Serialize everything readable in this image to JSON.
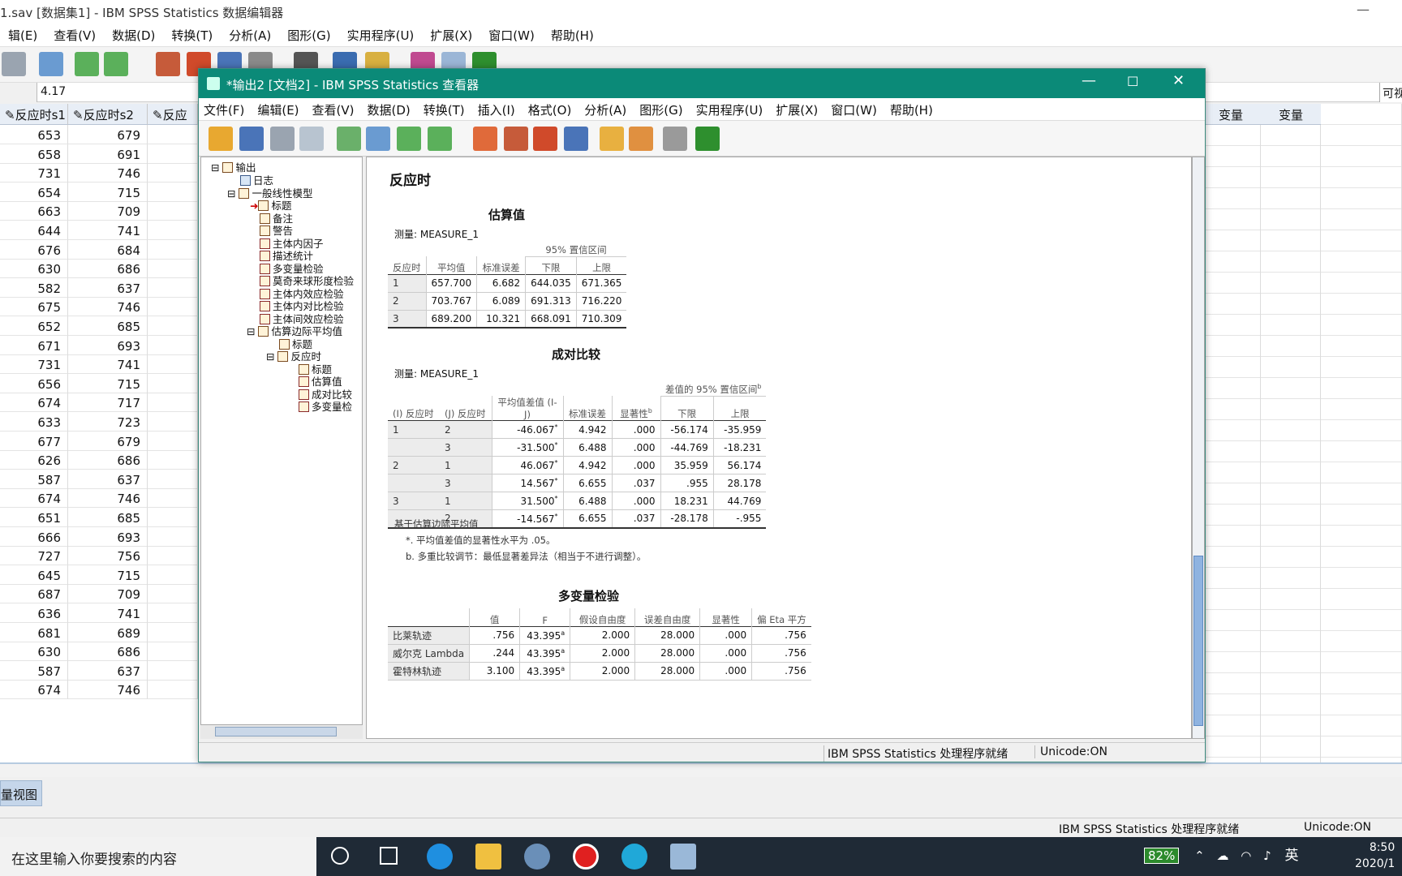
{
  "data_editor": {
    "title": "1.sav [数据集1] - IBM SPSS Statistics 数据编辑器",
    "menu": [
      "辑(E)",
      "查看(V)",
      "数据(D)",
      "转换(T)",
      "分析(A)",
      "图形(G)",
      "实用程序(U)",
      "扩展(X)",
      "窗口(W)",
      "帮助(H)"
    ],
    "cell_value": "4.17",
    "visible_label": "可视",
    "columns": [
      "反应时s1",
      "反应时s2",
      "反应"
    ],
    "rows": [
      [
        "653",
        "679"
      ],
      [
        "658",
        "691"
      ],
      [
        "731",
        "746"
      ],
      [
        "654",
        "715"
      ],
      [
        "663",
        "709"
      ],
      [
        "644",
        "741"
      ],
      [
        "676",
        "684"
      ],
      [
        "630",
        "686"
      ],
      [
        "582",
        "637"
      ],
      [
        "675",
        "746"
      ],
      [
        "652",
        "685"
      ],
      [
        "671",
        "693"
      ],
      [
        "731",
        "741"
      ],
      [
        "656",
        "715"
      ],
      [
        "674",
        "717"
      ],
      [
        "633",
        "723"
      ],
      [
        "677",
        "679"
      ],
      [
        "626",
        "686"
      ],
      [
        "587",
        "637"
      ],
      [
        "674",
        "746"
      ],
      [
        "651",
        "685"
      ],
      [
        "666",
        "693"
      ],
      [
        "727",
        "756"
      ],
      [
        "645",
        "715"
      ],
      [
        "687",
        "709"
      ],
      [
        "636",
        "741"
      ],
      [
        "681",
        "689"
      ],
      [
        "630",
        "686"
      ],
      [
        "587",
        "637"
      ],
      [
        "674",
        "746"
      ]
    ],
    "right_columns": [
      "变量",
      "变量"
    ],
    "tab_variable_view": "量视图",
    "status_ready": "IBM SPSS Statistics 处理程序就绪",
    "status_unicode": "Unicode:ON"
  },
  "viewer": {
    "title": "*输出2 [文档2] - IBM SPSS Statistics 查看器",
    "menu": [
      "文件(F)",
      "编辑(E)",
      "查看(V)",
      "数据(D)",
      "转换(T)",
      "插入(I)",
      "格式(O)",
      "分析(A)",
      "图形(G)",
      "实用程序(U)",
      "扩展(X)",
      "窗口(W)",
      "帮助(H)"
    ],
    "outline": [
      "输出",
      "日志",
      "一般线性模型",
      "标题",
      "备注",
      "警告",
      "主体内因子",
      "描述统计",
      "多变量检验",
      "莫奇来球形度检验",
      "主体内效应检验",
      "主体内对比检验",
      "主体间效应检验",
      "估算边际平均值",
      "标题",
      "反应时",
      "标题",
      "估算值",
      "成对比较",
      "多变量检"
    ],
    "status_ready": "IBM SPSS Statistics 处理程序就绪",
    "status_unicode": "Unicode:ON"
  },
  "output": {
    "heading": "反应时",
    "estimates": {
      "title": "估算值",
      "measure": "测量:   MEASURE_1",
      "ci_header": "95% 置信区间",
      "headers": [
        "反应时",
        "平均值",
        "标准误差",
        "下限",
        "上限"
      ],
      "rows": [
        [
          "1",
          "657.700",
          "6.682",
          "644.035",
          "671.365"
        ],
        [
          "2",
          "703.767",
          "6.089",
          "691.313",
          "716.220"
        ],
        [
          "3",
          "689.200",
          "10.321",
          "668.091",
          "710.309"
        ]
      ]
    },
    "pairwise": {
      "title": "成对比较",
      "measure": "测量:   MEASURE_1",
      "ci_header": "差值的 95% 置信区间",
      "ci_sup": "b",
      "headers": [
        "(I) 反应时",
        "(J) 反应时",
        "平均值差值 (I-J)",
        "标准误差",
        "显著性",
        "下限",
        "上限"
      ],
      "sig_sup": "b",
      "rows": [
        [
          "1",
          "2",
          "-46.067",
          "4.942",
          ".000",
          "-56.174",
          "-35.959"
        ],
        [
          "",
          "3",
          "-31.500",
          "6.488",
          ".000",
          "-44.769",
          "-18.231"
        ],
        [
          "2",
          "1",
          "46.067",
          "4.942",
          ".000",
          "35.959",
          "56.174"
        ],
        [
          "",
          "3",
          "14.567",
          "6.655",
          ".037",
          ".955",
          "28.178"
        ],
        [
          "3",
          "1",
          "31.500",
          "6.488",
          ".000",
          "18.231",
          "44.769"
        ],
        [
          "",
          "2",
          "-14.567",
          "6.655",
          ".037",
          "-28.178",
          "-.955"
        ]
      ],
      "star": "*",
      "notes": [
        "基于估算边际平均值",
        "*. 平均值差值的显著性水平为 .05。",
        "b. 多重比较调节：最低显著差异法（相当于不进行调整）。"
      ]
    },
    "multivariate": {
      "title": "多变量检验",
      "headers": [
        "",
        "值",
        "F",
        "假设自由度",
        "误差自由度",
        "显著性",
        "偏 Eta 平方"
      ],
      "sup": "a",
      "rows": [
        [
          "比莱轨迹",
          ".756",
          "43.395",
          "2.000",
          "28.000",
          ".000",
          ".756"
        ],
        [
          "威尔克 Lambda",
          ".244",
          "43.395",
          "2.000",
          "28.000",
          ".000",
          ".756"
        ],
        [
          "霍特林轨迹",
          "3.100",
          "43.395",
          "2.000",
          "28.000",
          ".000",
          ".756"
        ]
      ]
    }
  },
  "taskbar": {
    "search_placeholder": "在这里输入你要搜索的内容",
    "battery": "82%",
    "ime": "英",
    "time": "8:50",
    "date": "2020/1"
  },
  "colors": {
    "viewer_title": "#0b8a78",
    "taskbar": "#1f2a36"
  }
}
